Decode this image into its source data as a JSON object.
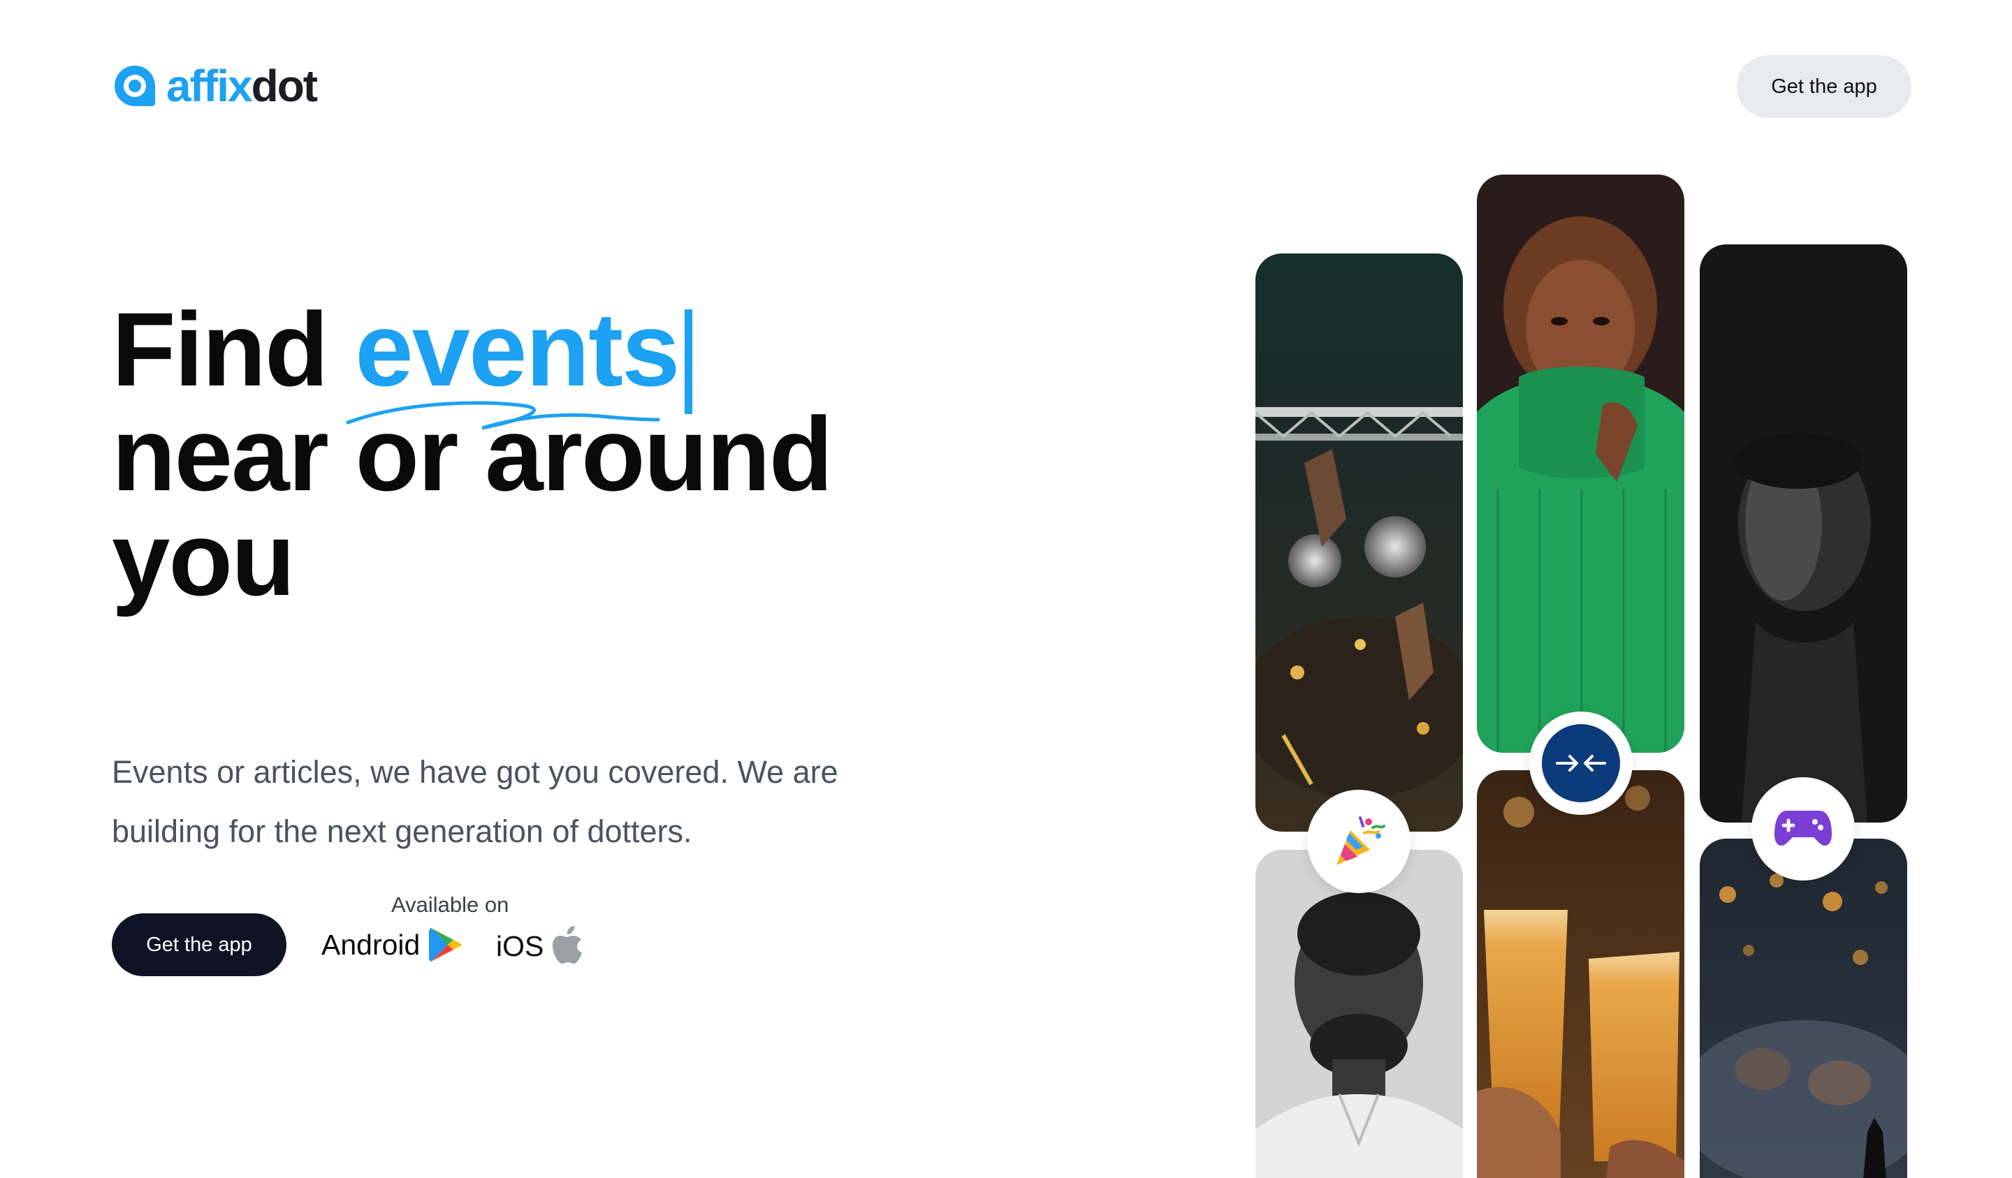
{
  "brand": {
    "name_part1": "affix",
    "name_part2": "dot",
    "accent": "#1da1f2",
    "icon": "speech-bubble-logo-icon"
  },
  "nav": {
    "cta_label": "Get the app"
  },
  "hero": {
    "title_word1": "Find",
    "title_accent": "events",
    "title_line2": "near or around",
    "title_line3": "you",
    "subtitle": "Events or articles, we have got you covered. We are building for the next generation of dotters."
  },
  "cta": {
    "label": "Get the app",
    "available_on": "Available on",
    "android_label": "Android",
    "ios_label": "iOS",
    "android_icon": "google-play-icon",
    "ios_icon": "apple-icon"
  },
  "badges": {
    "party": "party-popper-icon",
    "connect": "arrows-converge-icon",
    "gaming": "game-controller-icon"
  },
  "colors": {
    "dark_button": "#0f1424",
    "light_button": "#e8eaed",
    "badge_blue": "#0b3b7a",
    "controller_purple": "#7b3fd6"
  }
}
